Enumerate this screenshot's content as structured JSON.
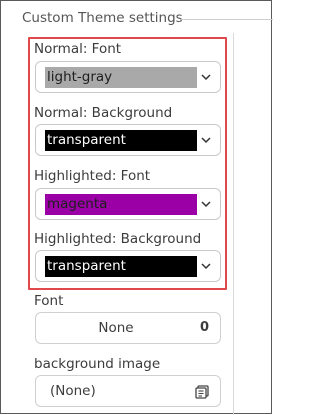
{
  "panel": {
    "title": "Custom Theme settings"
  },
  "normal_font": {
    "label": "Normal: Font",
    "value": "light-gray",
    "swatch_color": "#a9a9a9",
    "text_color": "#1e1e1e"
  },
  "normal_background": {
    "label": "Normal: Background",
    "value": "transparent",
    "swatch_color": "#000000",
    "text_color": "#ffffff"
  },
  "highlighted_font": {
    "label": "Highlighted: Font",
    "value": "magenta",
    "swatch_color": "#9a00a6",
    "text_color": "#1e1e1e"
  },
  "highlighted_background": {
    "label": "Highlighted: Background",
    "value": "transparent",
    "swatch_color": "#000000",
    "text_color": "#ffffff"
  },
  "font": {
    "label": "Font",
    "value": "None",
    "size": "0"
  },
  "background_image": {
    "label": "background image",
    "value": "(None)"
  },
  "colors": {
    "highlight_border": "#e0484c"
  }
}
